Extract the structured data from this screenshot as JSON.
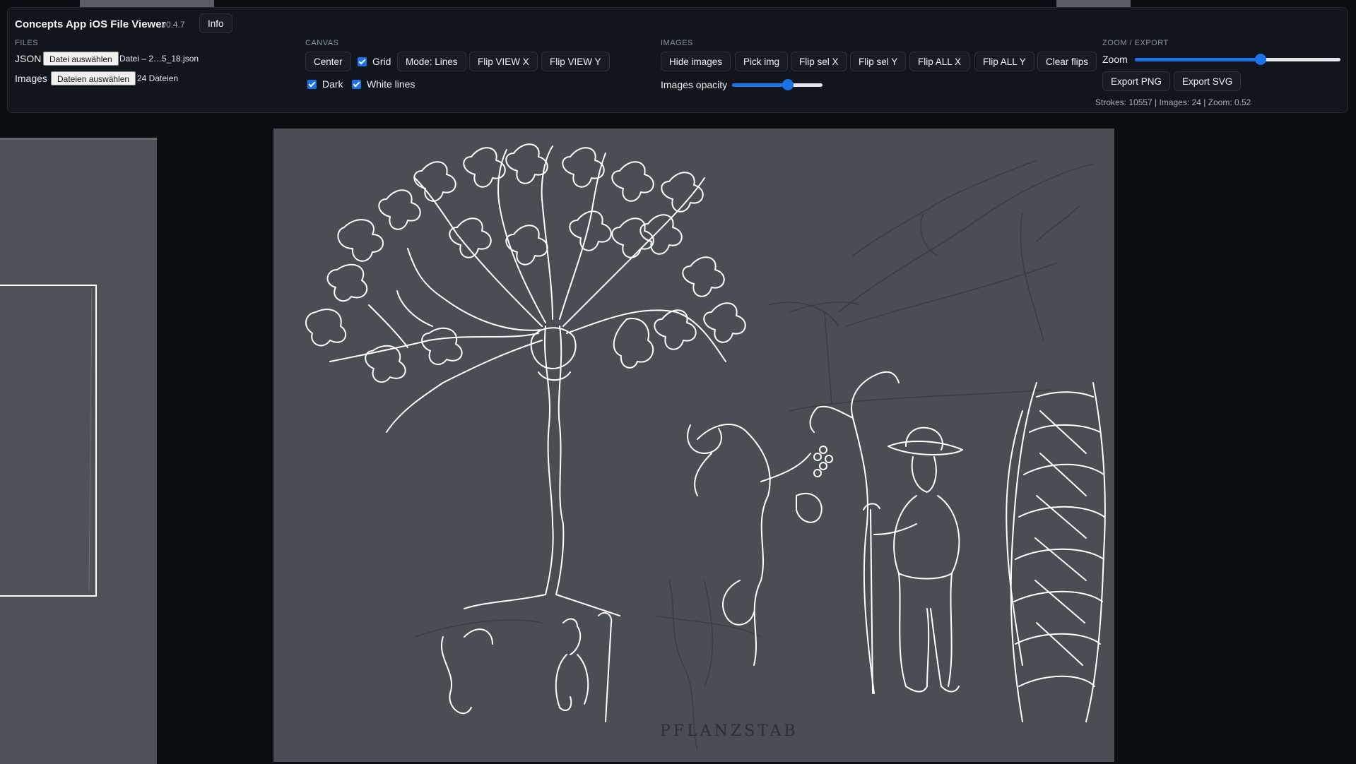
{
  "app": {
    "title": "Concepts App iOS File Viewer",
    "version": "v0.4.7",
    "info_label": "Info"
  },
  "files": {
    "section": "FILES",
    "json_label": "JSON",
    "json_button": "Datei auswählen",
    "json_filename": "Datei – 2…5_18.json",
    "images_label": "Images",
    "images_button": "Dateien auswählen",
    "images_count": "24 Dateien"
  },
  "canvas": {
    "section": "CANVAS",
    "center": "Center",
    "grid": "Grid",
    "grid_checked": true,
    "mode": "Mode: Lines",
    "flip_view_x": "Flip VIEW X",
    "flip_view_y": "Flip VIEW Y",
    "dark": "Dark",
    "dark_checked": true,
    "white_lines": "White lines",
    "white_lines_checked": true
  },
  "images": {
    "section": "IMAGES",
    "hide_images": "Hide images",
    "pick_img": "Pick img",
    "flip_sel_x": "Flip sel X",
    "flip_sel_y": "Flip sel Y",
    "flip_all_x": "Flip ALL X",
    "flip_all_y": "Flip ALL Y",
    "clear_flips": "Clear flips",
    "opacity_label": "Images opacity",
    "opacity_value": 0.62
  },
  "zoom_export": {
    "section": "ZOOM / EXPORT",
    "zoom_label": "Zoom",
    "zoom_level": 0.61,
    "export_png": "Export PNG",
    "export_svg": "Export SVG",
    "status": "Strokes: 10557 | Images: 24 | Zoom: 0.52"
  },
  "drawing": {
    "caption": "PFLANZSTAB"
  },
  "colors": {
    "accent": "#1a73e8",
    "panel_bg": "#11151c",
    "canvas_bg": "#0a0d12",
    "drawing_bg": "#4a4d53"
  }
}
